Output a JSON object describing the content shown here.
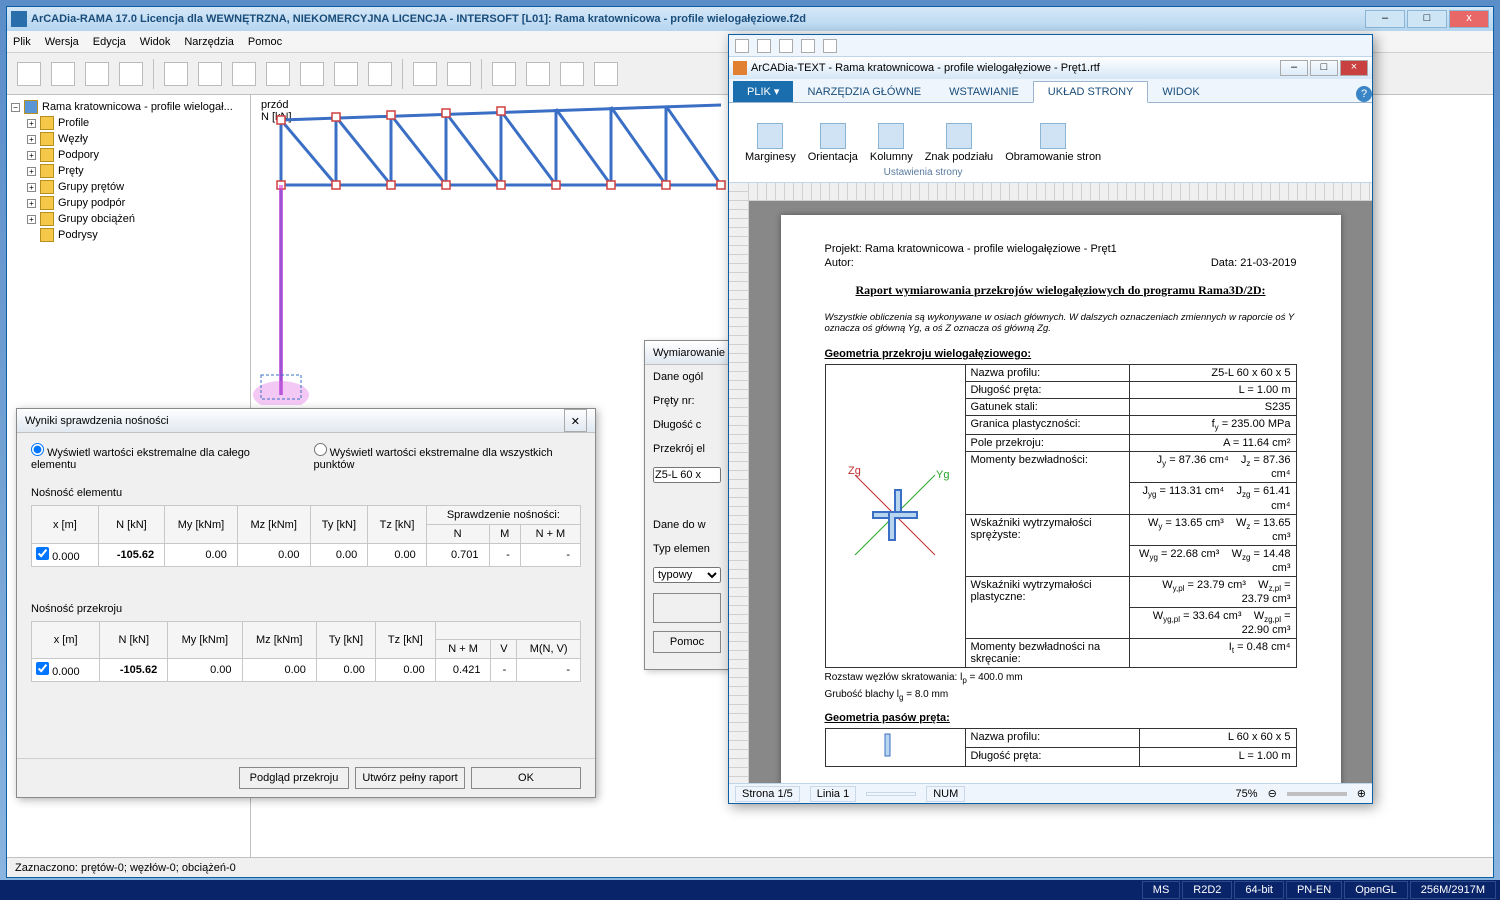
{
  "main_window": {
    "title": "ArCADia-RAMA 17.0 Licencja dla WEWNĘTRZNA, NIEKOMERCYJNA LICENCJA - INTERSOFT [L01]: Rama kratownicowa - profile wielogałęziowe.f2d",
    "menus": [
      "Plik",
      "Wersja",
      "Edycja",
      "Widok",
      "Narzędzia",
      "Pomoc"
    ],
    "status": "Zaznaczono: prętów-0; węzłów-0; obciążeń-0"
  },
  "tree": {
    "root": "Rama kratownicowa - profile wielogał...",
    "items": [
      "Profile",
      "Węzły",
      "Podpory",
      "Pręty",
      "Grupy prętów",
      "Grupy podpór",
      "Grupy obciążeń",
      "Podrysy"
    ]
  },
  "canvas": {
    "axis1": "przód",
    "axis2": "N [kN]"
  },
  "bottom_tags": [
    "MS",
    "R2D2",
    "64-bit",
    "PN-EN",
    "OpenGL",
    "256M/2917M"
  ],
  "results": {
    "title": "Wyniki sprawdzenia nośności",
    "radio1": "Wyświetl wartości ekstremalne dla całego elementu",
    "radio2": "Wyświetl wartości ekstremalne dla wszystkich punktów",
    "section1": "Nośność elementu",
    "section2": "Nośność przekroju",
    "headers": {
      "x": "x [m]",
      "N": "N [kN]",
      "My": "My [kNm]",
      "Mz": "Mz [kNm]",
      "Ty": "Ty [kN]",
      "Tz": "Tz [kN]",
      "group": "Sprawdzenie nośności:",
      "Nc": "N",
      "Mc": "M",
      "NM": "N + M",
      "NMs": "N + M",
      "V": "V",
      "MNV": "M(N, V)"
    },
    "row1": {
      "x": "0.000",
      "N": "-105.62",
      "My": "0.00",
      "Mz": "0.00",
      "Ty": "0.00",
      "Tz": "0.00",
      "c1": "0.701",
      "c2": "-",
      "c3": "-"
    },
    "row2": {
      "x": "0.000",
      "N": "-105.62",
      "My": "0.00",
      "Mz": "0.00",
      "Ty": "0.00",
      "Tz": "0.00",
      "c1": "0.421",
      "c2": "-",
      "c3": "-"
    },
    "btn1": "Podgląd przekroju",
    "btn2": "Utwórz pełny raport",
    "btn3": "OK"
  },
  "dim": {
    "title": "Wymiarowanie",
    "l1": "Dane ogól",
    "l2": "Pręty nr:",
    "l3": "Długość c",
    "l4": "Przekrój el",
    "val": "Z5-L 60 x",
    "l5": "Dane do w",
    "l6": "Typ elemen",
    "sel": "typowy",
    "btn": "Pomoc"
  },
  "editor": {
    "title": "ArCADia-TEXT - Rama kratownicowa - profile wielogałęziowe - Pręt1.rtf",
    "file": "PLIK",
    "tabs": [
      "NARZĘDZIA GŁÓWNE",
      "WSTAWIANIE",
      "UKŁAD STRONY",
      "WIDOK"
    ],
    "active_tab": 2,
    "ribbon": {
      "items": [
        "Marginesy",
        "Orientacja",
        "Kolumny",
        "Znak podziału",
        "Obramowanie stron"
      ],
      "group": "Ustawienia strony"
    },
    "status": {
      "page": "Strona 1/5",
      "line": "Linia 1",
      "num": "NUM",
      "zoom": "75%"
    }
  },
  "report": {
    "proj_label": "Projekt:",
    "proj": "Rama kratownicowa - profile wielogałęziowe - Pręt1",
    "author_label": "Autor:",
    "date_label": "Data:",
    "date": "21-03-2019",
    "h1": "Raport wymiarowania przekrojów wielogałęziowych do programu Rama3D/2D:",
    "note": "Wszystkie obliczenia są wykonywane w osiach głównych. W dalszych oznaczeniach zmiennych w raporcie oś Y oznacza oś główną Yg, a oś Z oznacza oś główną Zg.",
    "h2a": "Geometria przekroju wielogałęziowego:",
    "rows": [
      {
        "l": "Nazwa profilu:",
        "r": "Z5-L 60 x 60 x 5"
      },
      {
        "l": "Długość pręta:",
        "r": "L = 1.00 m"
      },
      {
        "l": "Gatunek stali:",
        "r": "S235"
      },
      {
        "l": "Granica plastyczności:",
        "r": "f<sub>y</sub> = 235.00 MPa"
      },
      {
        "l": "Pole przekroju:",
        "r": "A = 11.64 cm²"
      }
    ],
    "moments_label": "Momenty bezwładności:",
    "Jy": "J<sub>y</sub> = 87.36 cm⁴",
    "Jz": "J<sub>z</sub> = 87.36 cm⁴",
    "Jyg": "J<sub>yg</sub> = 113.31 cm⁴",
    "Jzg": "J<sub>zg</sub> = 61.41 cm⁴",
    "wsp_label": "Wskaźniki wytrzymałości sprężyste:",
    "Wy": "W<sub>y</sub> = 13.65 cm³",
    "Wz": "W<sub>z</sub> = 13.65 cm³",
    "Wyg": "W<sub>yg</sub> = 22.68 cm³",
    "Wzg": "W<sub>zg</sub> = 14.48 cm³",
    "wpl_label": "Wskaźniki wytrzymałości plastyczne:",
    "Wypl": "W<sub>y,pl</sub> = 23.79 cm³",
    "Wzpl": "W<sub>z,pl</sub> = 23.79 cm³",
    "Wygpl": "W<sub>yg,pl</sub> = 33.64 cm³",
    "Wzgpl": "W<sub>zg,pl</sub> = 22.90 cm³",
    "It_label": "Momenty bezwładności na skręcanie:",
    "It": "I<sub>t</sub> = 0.48 cm⁴",
    "p1": "Rozstaw węzłów skratowania: l<sub>p</sub> = 400.0 mm",
    "p2": "Grubość blachy l<sub>g</sub> = 8.0 mm",
    "h2b": "Geometria pasów pręta:",
    "rows2": [
      {
        "l": "Nazwa profilu:",
        "r": "L 60 x 60 x 5"
      },
      {
        "l": "Długość pręta:",
        "r": "L = 1.00 m"
      }
    ]
  }
}
